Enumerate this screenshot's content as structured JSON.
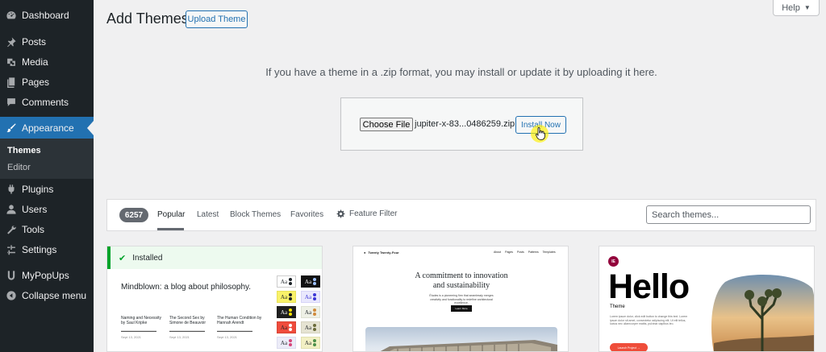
{
  "sidebar": {
    "items": [
      {
        "label": "Dashboard",
        "icon": "dashboard-icon"
      },
      {
        "label": "Posts",
        "icon": "pushpin-icon"
      },
      {
        "label": "Media",
        "icon": "media-icon"
      },
      {
        "label": "Pages",
        "icon": "pages-icon"
      },
      {
        "label": "Comments",
        "icon": "comment-icon"
      },
      {
        "label": "Appearance",
        "icon": "paintbrush-icon"
      },
      {
        "label": "Plugins",
        "icon": "plugin-icon"
      },
      {
        "label": "Users",
        "icon": "user-icon"
      },
      {
        "label": "Tools",
        "icon": "wrench-icon"
      },
      {
        "label": "Settings",
        "icon": "settings-icon"
      },
      {
        "label": "MyPopUps",
        "icon": "mypopups-icon"
      },
      {
        "label": "Collapse menu",
        "icon": "collapse-icon"
      }
    ],
    "submenu": [
      {
        "label": "Themes"
      },
      {
        "label": "Editor"
      }
    ],
    "colors": {
      "bg": "#1d2327",
      "active": "#2271b1",
      "submenu_bg": "#2c3338"
    }
  },
  "header": {
    "title": "Add Themes",
    "upload_button": "Upload Theme",
    "help_label": "Help"
  },
  "upload": {
    "instructions": "If you have a theme in a .zip format, you may install or update it by uploading it here.",
    "choose_file_label": "Choose File",
    "file_name": "jupiter-x-83...0486259.zip",
    "install_button": "Install Now"
  },
  "filter": {
    "count": "6257",
    "tabs": [
      "Popular",
      "Latest",
      "Block Themes",
      "Favorites"
    ],
    "active_tab": "Popular",
    "feature_filter": "Feature Filter",
    "search_placeholder": "Search themes..."
  },
  "themes": [
    {
      "installed_label": "Installed",
      "headline": "Mindblown: a blog about philosophy.",
      "posts": [
        {
          "title": "Naming and Necessity by Saul Kripke",
          "date": "Sept 13, 2021"
        },
        {
          "title": "The Second Sex by Simone de Beauvoir",
          "date": "Sept 13, 2021"
        },
        {
          "title": "The Human Condition by Hannah Arendt",
          "date": "Sept 13, 2021"
        }
      ],
      "swatch_label": "Aa"
    },
    {
      "brand": "Twenty Twenty-Four",
      "menu": "About Pages Posts Patterns Templates",
      "headline_line1": "A commitment to innovation",
      "headline_line2": "and sustainability",
      "description": "Études is a pioneering firm that seamlessly merges creativity and functionality to redefine architectural excellence.",
      "button": "Learn More"
    },
    {
      "logo": "IE",
      "headline": "Hello",
      "subtitle": "Theme",
      "description": "Lorem ipsum dolor, click edit button to change this text. Lorem ipsum dolor sit amet, consectetur adipiscing elit. Ut elit tellus, luctus nec ullamcorper mattis, pulvinar dapibus leo.",
      "button": "Launch Project →"
    }
  ]
}
